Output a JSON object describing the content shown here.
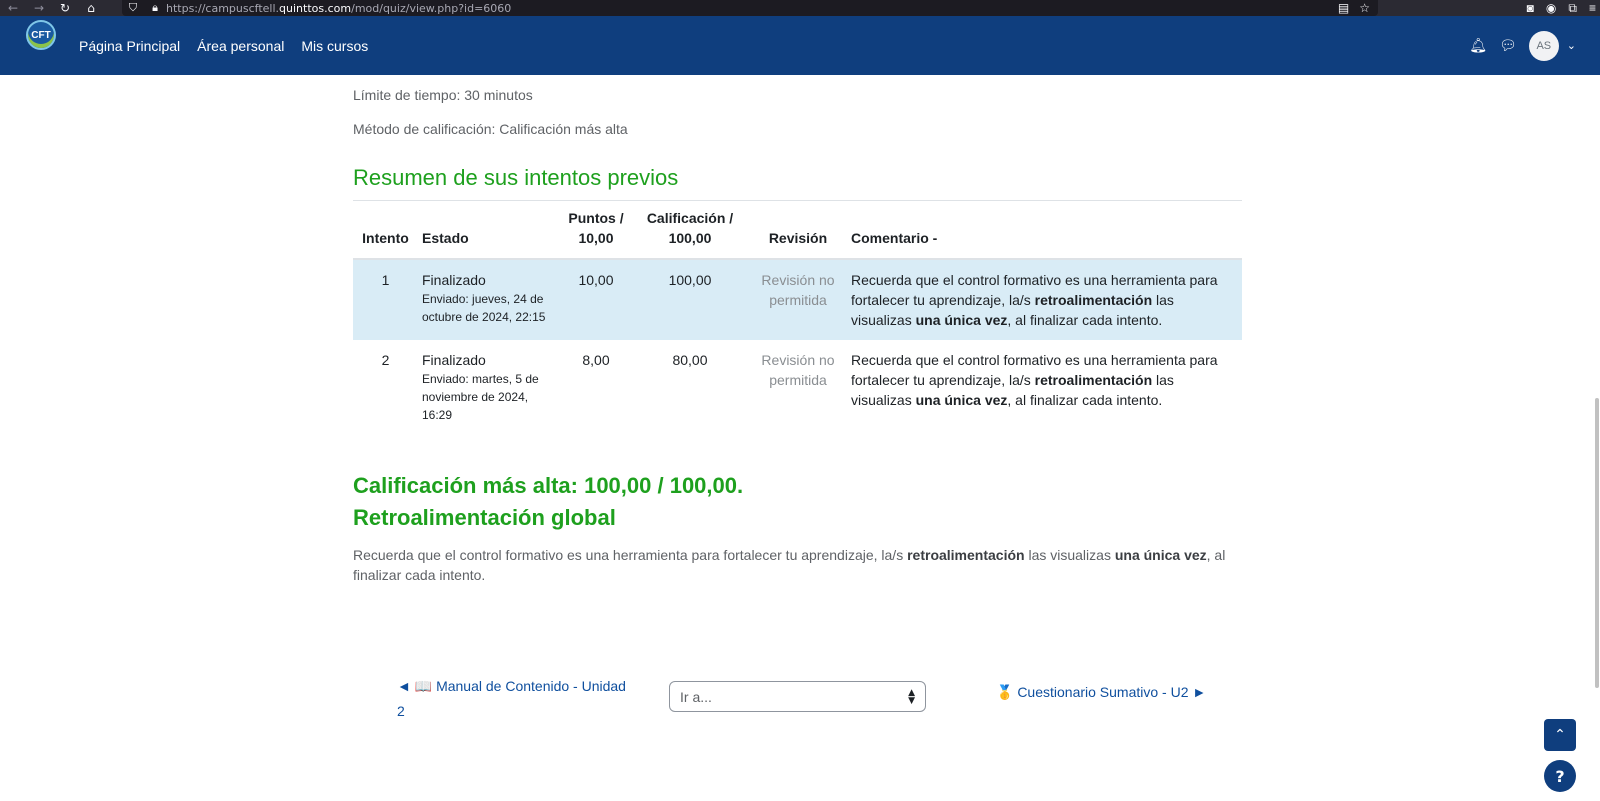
{
  "browser": {
    "url_prefix": "https://campuscftell.",
    "url_host": "quinttos.com",
    "url_path": "/mod/quiz/view.php?id=6060"
  },
  "navbar": {
    "links": [
      "Página Principal",
      "Área personal",
      "Mis cursos"
    ],
    "avatar_initials": "AS"
  },
  "quiz_info": {
    "time_limit": "Límite de tiempo: 30 minutos",
    "grading_method": "Método de calificación: Calificación más alta"
  },
  "attempts": {
    "heading": "Resumen de sus intentos previos",
    "columns": {
      "attempt": "Intento",
      "state": "Estado",
      "points_line1": "Puntos /",
      "points_line2": "10,00",
      "grade_line1": "Calificación /",
      "grade_line2": "100,00",
      "review": "Revisión",
      "comment": "Comentario -"
    },
    "rows": [
      {
        "attempt": "1",
        "state": "Finalizado",
        "submitted": "Enviado: jueves, 24 de octubre de 2024, 22:15",
        "points": "10,00",
        "grade": "100,00",
        "review": "Revisión no permitida",
        "comment_a": "Recuerda que el control formativo es una herramienta para fortalecer tu aprendizaje, la/s ",
        "comment_b": "retroalimentación",
        "comment_c": " las visualizas ",
        "comment_d": "una única vez",
        "comment_e": ", al finalizar cada intento."
      },
      {
        "attempt": "2",
        "state": "Finalizado",
        "submitted": "Enviado: martes, 5 de noviembre de 2024, 16:29",
        "points": "8,00",
        "grade": "80,00",
        "review": "Revisión no permitida",
        "comment_a": "Recuerda que el control formativo es una herramienta para fortalecer tu aprendizaje, la/s ",
        "comment_b": "retroalimentación",
        "comment_c": " las visualizas ",
        "comment_d": "una única vez",
        "comment_e": ", al finalizar cada intento."
      }
    ]
  },
  "summary": {
    "highest_grade": "Calificación más alta: 100,00 / 100,00.",
    "global_feedback_title": "Retroalimentación global",
    "fb_a": "Recuerda que el control formativo es una herramienta para fortalecer tu aprendizaje, la/s ",
    "fb_b": "retroalimentación",
    "fb_c": " las visualizas ",
    "fb_d": "una única vez",
    "fb_e": ", al finalizar cada intento."
  },
  "activity_nav": {
    "prev_label": "◄ 📖 Manual de Contenido - Unidad 2",
    "jump_placeholder": "Ir a...",
    "next_label": "🥇 Cuestionario Sumativo -  U2 ►"
  },
  "colors": {
    "navbar": "#0f3e7e",
    "heading_green": "#1ea01e",
    "row_highlight": "#d9ecf6",
    "link": "#0f4f9e"
  }
}
